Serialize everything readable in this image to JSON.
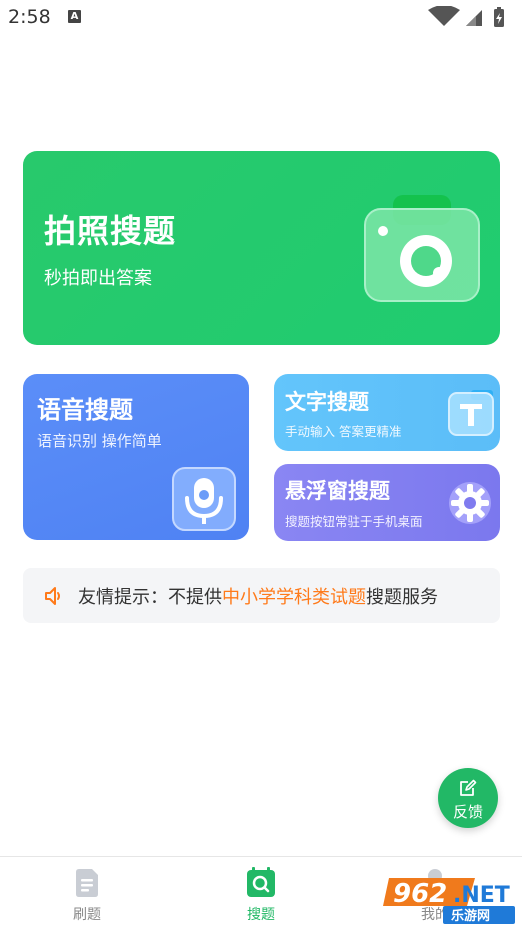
{
  "status_bar": {
    "time": "2:58",
    "notif_letter": "A"
  },
  "photo_card": {
    "title": "拍照搜题",
    "subtitle": "秒拍即出答案",
    "icon": "camera-icon"
  },
  "voice_card": {
    "title": "语音搜题",
    "subtitle": "语音识别 操作简单",
    "icon": "microphone-icon"
  },
  "text_card": {
    "title": "文字搜题",
    "subtitle": "手动输入 答案更精准",
    "icon": "text-t-icon"
  },
  "float_card": {
    "title": "悬浮窗搜题",
    "subtitle": "搜题按钮常驻于手机桌面",
    "icon": "gear-icon"
  },
  "tip": {
    "prefix": "友情提示：不提供",
    "highlight": "中小学学科类试题",
    "suffix": "搜题服务",
    "highlight_color": "#ff7a1a"
  },
  "feedback": {
    "label": "反馈"
  },
  "tabs": [
    {
      "label": "刷题",
      "icon": "document-icon",
      "active": false
    },
    {
      "label": "搜题",
      "icon": "search-book-icon",
      "active": true
    },
    {
      "label": "我的",
      "icon": "profile-icon",
      "active": false
    }
  ],
  "watermark": {
    "text": "962.NET 乐游网"
  },
  "colors": {
    "accent": "#22b866",
    "voice": "#5589f6",
    "text": "#5fc1fa",
    "float": "#8480f1"
  }
}
